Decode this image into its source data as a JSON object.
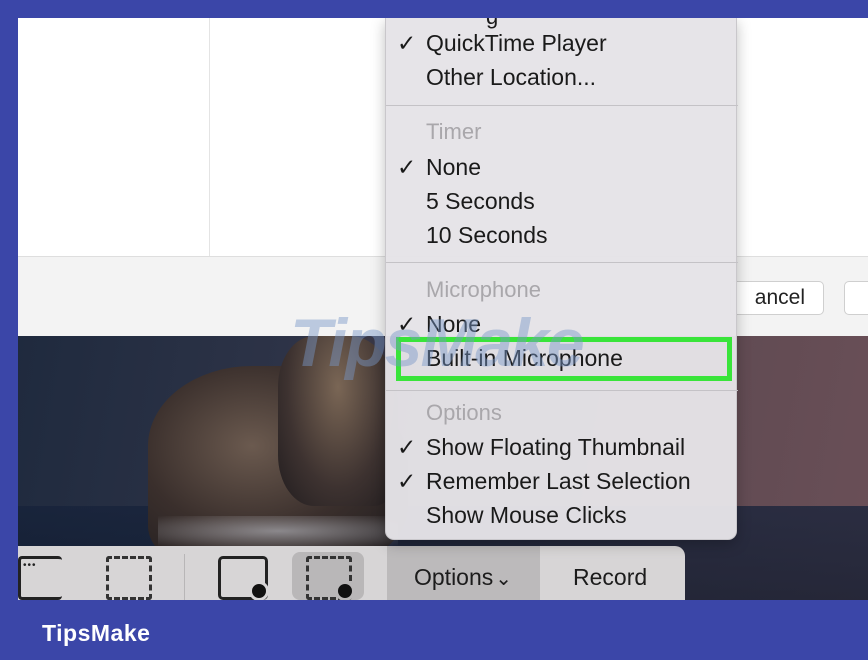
{
  "dialog": {
    "cancel_label": "ancel"
  },
  "menu": {
    "save_to": {
      "items": [
        {
          "label": "QuickTime Player",
          "checked": true
        },
        {
          "label": "Other Location...",
          "checked": false
        }
      ]
    },
    "timer": {
      "header": "Timer",
      "items": [
        {
          "label": "None",
          "checked": true
        },
        {
          "label": "5 Seconds",
          "checked": false
        },
        {
          "label": "10 Seconds",
          "checked": false
        }
      ]
    },
    "microphone": {
      "header": "Microphone",
      "items": [
        {
          "label": "None",
          "checked": true
        },
        {
          "label": "Built-in Microphone",
          "checked": false,
          "highlighted": true
        }
      ]
    },
    "options": {
      "header": "Options",
      "items": [
        {
          "label": "Show Floating Thumbnail",
          "checked": true
        },
        {
          "label": "Remember Last Selection",
          "checked": true
        },
        {
          "label": "Show Mouse Clicks",
          "checked": false
        }
      ]
    },
    "check_glyph": "✓",
    "highlight_color": "#39e43a"
  },
  "toolbar": {
    "options_label": "Options",
    "options_chevron": "⌄",
    "record_label": "Record",
    "icons": [
      "capture-window-icon",
      "capture-selection-icon",
      "record-window-icon",
      "record-selection-icon"
    ]
  },
  "watermark": "TipsMake",
  "brand": "TipsMake",
  "colors": {
    "frame": "#3b46a8",
    "menu_bg": "#e5e3e7"
  }
}
